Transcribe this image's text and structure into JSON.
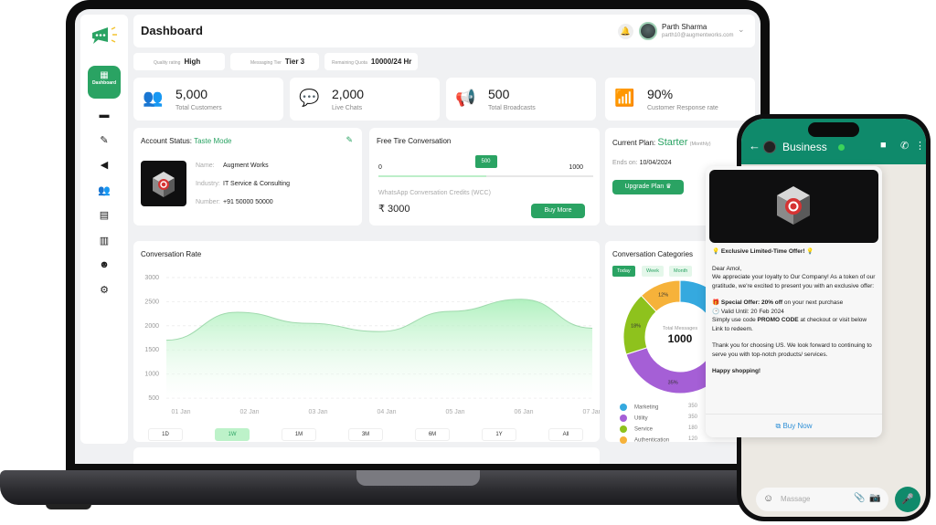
{
  "header": {
    "title": "Dashboard",
    "user_name": "Parth Sharma",
    "user_email": "parth10@augmentworks.com"
  },
  "sidebar": {
    "active_label": "Dashboard",
    "items": [
      {
        "icon": "dashboard-icon",
        "label": "Dashboard"
      },
      {
        "icon": "chat-icon"
      },
      {
        "icon": "campaign-icon"
      },
      {
        "icon": "broadcast-icon"
      },
      {
        "icon": "contacts-icon"
      },
      {
        "icon": "template-icon"
      },
      {
        "icon": "analytics-icon"
      },
      {
        "icon": "bot-icon"
      },
      {
        "icon": "settings-icon"
      }
    ]
  },
  "pills": [
    {
      "key": "Quality rating",
      "value": "High"
    },
    {
      "key": "Messaging Tier",
      "value": "Tier 3"
    },
    {
      "key": "Remaining Quota",
      "value": "10000/24 Hr"
    }
  ],
  "stats": [
    {
      "value": "5,000",
      "label": "Total Customers",
      "icon": "customers-icon"
    },
    {
      "value": "2,000",
      "label": "Live Chats",
      "icon": "live-chat-icon"
    },
    {
      "value": "500",
      "label": "Total Broadcasts",
      "icon": "broadcast-icon"
    },
    {
      "value": "90%",
      "label": "Customer Response rate",
      "icon": "response-rate-icon"
    }
  ],
  "account": {
    "heading": "Account Status:",
    "status": "Taste Mode",
    "fields": [
      {
        "key": "Name:",
        "value": "Augment Works"
      },
      {
        "key": "Industry:",
        "value": "IT Service & Consulting"
      },
      {
        "key": "Number:",
        "value": "+91 50000 50000"
      }
    ]
  },
  "free_tier": {
    "heading": "Free Tire Conversation",
    "min": "0",
    "max": "1000",
    "current": "500",
    "progress": 0.5,
    "wcc_label": "WhatsApp Conversation Credits (WCC)",
    "wcc_value": "₹ 3000",
    "buy_more": "Buy More"
  },
  "plan": {
    "label": "Current Plan:",
    "name": "Starter",
    "cycle": "(Monthly)",
    "ends_label": "Ends on:",
    "ends_value": "10/04/2024",
    "upgrade": "Upgrade Plan"
  },
  "chart_data": {
    "type": "area",
    "title": "Conversation Rate",
    "xlabel": "",
    "ylabel": "",
    "categories": [
      "01 Jan",
      "02 Jan",
      "03 Jan",
      "04 Jan",
      "05 Jan",
      "06 Jan",
      "07 Jan"
    ],
    "values": [
      1700,
      2280,
      2050,
      1880,
      2300,
      2550,
      1950
    ],
    "yticks": [
      500,
      1000,
      1500,
      2000,
      2500,
      3000
    ],
    "ylim": [
      500,
      3000
    ],
    "grid": true,
    "ranges": [
      "1D",
      "1W",
      "1M",
      "3M",
      "6M",
      "1Y",
      "All"
    ],
    "active_range": "1W"
  },
  "categories": {
    "title": "Conversation Categories",
    "tabs": [
      "Today",
      "Week",
      "Month"
    ],
    "active_tab": "Today",
    "center_label": "Total Messages",
    "center_value": "1000",
    "slices": [
      {
        "name": "Marketing",
        "value": 350,
        "pct": "35%",
        "color": "#35a9df"
      },
      {
        "name": "Utility",
        "value": 350,
        "pct": "35%",
        "color": "#a55fd6"
      },
      {
        "name": "Service",
        "value": 180,
        "pct": "18%",
        "color": "#8ec21d"
      },
      {
        "name": "Authentication",
        "value": 120,
        "pct": "12%",
        "color": "#f6b23a"
      }
    ]
  },
  "phone": {
    "contact": "Business",
    "offer_title": "Exclusive Limited-Time Offer!",
    "greeting": "Dear Amol,",
    "para1": "We appreciate your loyalty to Our Company! As a token of our gratitude, we're excited to present you with an exclusive offer:",
    "special_bold": "Special Offer: 20% off",
    "special_rest": " on your next purchase",
    "valid": "Valid Until: 20 Feb 2024",
    "promo_pre": "Simply use code ",
    "promo_code": "PROMO CODE",
    "promo_post": " at checkout or visit below  Link to redeem.",
    "thanks": "Thank you for choosing US. We look forward to continuing to serve you with top-notch products/ services.",
    "closing": "Happy shopping!",
    "buy_now": "Buy Now",
    "input_placeholder": "Massage"
  },
  "colors": {
    "brand": "#2aa363",
    "whatsapp": "#0f8a6b",
    "link": "#2e8fd6"
  }
}
